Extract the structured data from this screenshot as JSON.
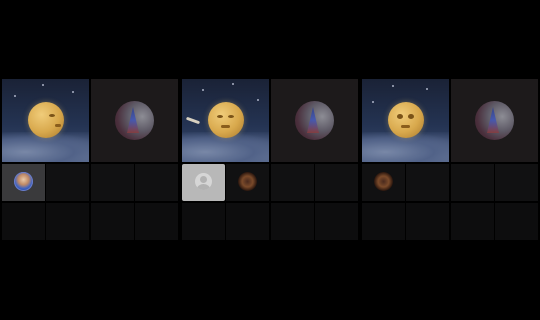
{
  "colors": {
    "background": "#000000",
    "tile": "#111112",
    "selected_tile": "#3a3a3c",
    "placeholder_tile": "#b8b8b8"
  },
  "panels": [
    {
      "preview_icon": "moon-scene-side-face",
      "camera_icon": "globe-camera-view",
      "avatars": [
        {
          "icon": "user-avatar-blue",
          "selected": true
        },
        {
          "icon": "",
          "selected": false
        },
        {
          "icon": "",
          "selected": false
        },
        {
          "icon": "",
          "selected": false
        }
      ]
    },
    {
      "preview_icon": "moon-scene-closed-eyes",
      "camera_icon": "globe-camera-view",
      "avatars": [
        {
          "icon": "default-user-placeholder",
          "selected": false
        },
        {
          "icon": "user-avatar-ornate",
          "selected": false
        },
        {
          "icon": "",
          "selected": false
        },
        {
          "icon": "",
          "selected": false
        }
      ]
    },
    {
      "preview_icon": "moon-scene-front-face",
      "camera_icon": "globe-camera-view",
      "avatars": [
        {
          "icon": "user-avatar-ornate",
          "selected": false
        },
        {
          "icon": "",
          "selected": false
        },
        {
          "icon": "",
          "selected": false
        },
        {
          "icon": "",
          "selected": false
        }
      ]
    }
  ]
}
